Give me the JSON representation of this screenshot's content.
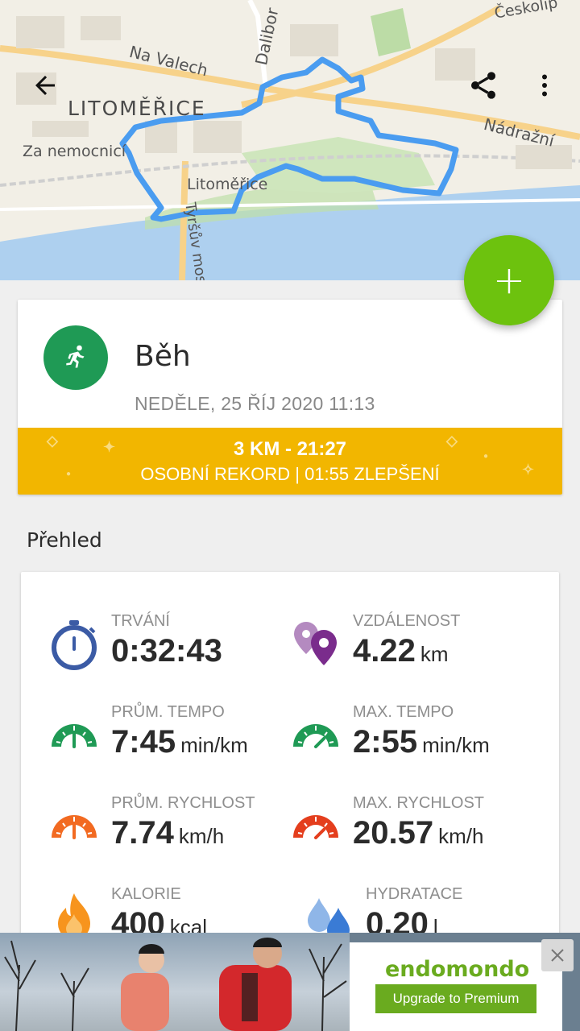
{
  "map": {
    "city_label": "LITOMĚŘICE",
    "streets": [
      "Na Valech",
      "Dalibor",
      "Za nemocnicí",
      "Litoměřice",
      "Nádražní",
      "Českolip",
      "Tyršův most"
    ]
  },
  "header": {
    "back_icon": "arrow-back-icon",
    "share_icon": "share-icon",
    "more_icon": "more-vert-icon"
  },
  "fab": {
    "label": "+"
  },
  "activity": {
    "sport": "Běh",
    "date": "NEDĚLE, 25 ŘÍJ 2020 11:13",
    "record_line1": "3 KM  -  21:27",
    "record_line2": "OSOBNÍ REKORD  |  01:55 ZLEPŠENÍ",
    "sport_color": "#1f9a55",
    "banner_color": "#f2b600"
  },
  "overview": {
    "title": "Přehled",
    "stats": [
      {
        "label": "TRVÁNÍ",
        "value": "0:32:43",
        "unit": "",
        "icon": "stopwatch-icon"
      },
      {
        "label": "VZDÁLENOST",
        "value": "4.22",
        "unit": "km",
        "icon": "location-pins-icon"
      },
      {
        "label": "PRŮM. TEMPO",
        "value": "7:45",
        "unit": "min/km",
        "icon": "speedometer-green-icon"
      },
      {
        "label": "MAX. TEMPO",
        "value": "2:55",
        "unit": "min/km",
        "icon": "speedometer-green-max-icon"
      },
      {
        "label": "PRŮM. RYCHLOST",
        "value": "7.74",
        "unit": "km/h",
        "icon": "speedometer-orange-icon"
      },
      {
        "label": "MAX. RYCHLOST",
        "value": "20.57",
        "unit": "km/h",
        "icon": "speedometer-red-icon"
      },
      {
        "label": "KALORIE",
        "value": "400",
        "unit": "kcal",
        "icon": "flame-icon"
      },
      {
        "label": "HYDRATACE",
        "value": "0.20",
        "unit": "l",
        "icon": "water-drops-icon"
      }
    ]
  },
  "ad": {
    "brand": "endomondo",
    "cta": "Upgrade to Premium"
  }
}
